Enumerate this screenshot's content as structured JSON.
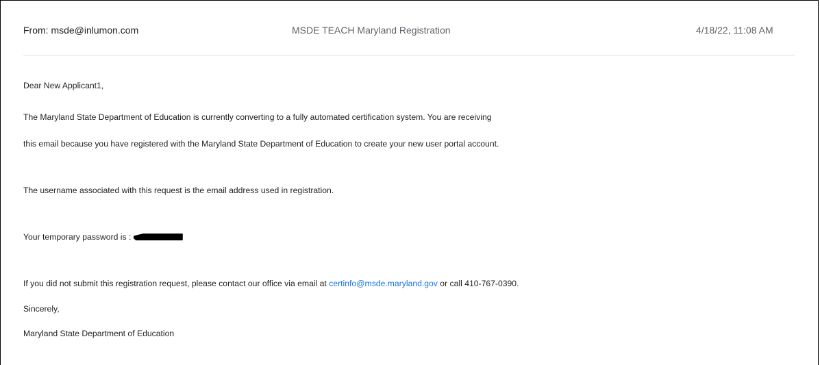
{
  "email": {
    "from": "From: msde@inlumon.com",
    "subject": "MSDE TEACH Maryland Registration",
    "date": "4/18/22, 11:08 AM",
    "greeting": "Dear New Applicant1,",
    "para1_line1": "The Maryland State Department of Education is currently converting to a fully automated certification system.  You are receiving",
    "para1_line2": "this email because you have registered with the Maryland State Department of Education to create your new user portal account.",
    "para2": "The username associated with this request is the email address used in registration.",
    "password_label": "Your temporary password is : ",
    "contact_prefix": "If you did not submit this registration request, please contact our office via email at ",
    "contact_email": "certinfo@msde.maryland.gov",
    "contact_suffix": " or call 410-767-0390.",
    "closing": "Sincerely,",
    "signature": "Maryland State Department of Education"
  },
  "colors": {
    "link": "#1a73e8",
    "meta_text": "#5f6368",
    "divider": "#e0e0e0"
  }
}
